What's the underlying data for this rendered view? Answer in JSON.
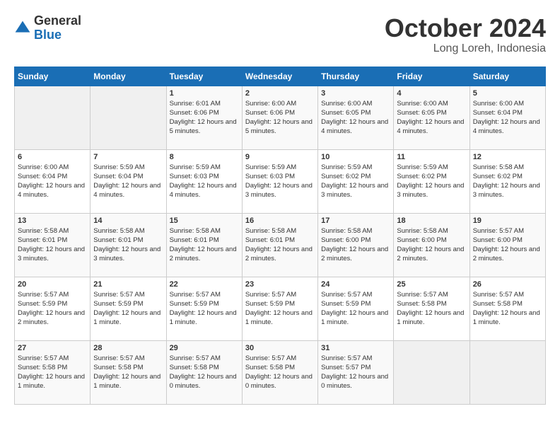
{
  "header": {
    "logo_general": "General",
    "logo_blue": "Blue",
    "month_title": "October 2024",
    "location": "Long Loreh, Indonesia"
  },
  "days_of_week": [
    "Sunday",
    "Monday",
    "Tuesday",
    "Wednesday",
    "Thursday",
    "Friday",
    "Saturday"
  ],
  "weeks": [
    [
      {
        "day": "",
        "empty": true
      },
      {
        "day": "",
        "empty": true
      },
      {
        "day": "1",
        "sunrise": "Sunrise: 6:01 AM",
        "sunset": "Sunset: 6:06 PM",
        "daylight": "Daylight: 12 hours and 5 minutes."
      },
      {
        "day": "2",
        "sunrise": "Sunrise: 6:00 AM",
        "sunset": "Sunset: 6:06 PM",
        "daylight": "Daylight: 12 hours and 5 minutes."
      },
      {
        "day": "3",
        "sunrise": "Sunrise: 6:00 AM",
        "sunset": "Sunset: 6:05 PM",
        "daylight": "Daylight: 12 hours and 4 minutes."
      },
      {
        "day": "4",
        "sunrise": "Sunrise: 6:00 AM",
        "sunset": "Sunset: 6:05 PM",
        "daylight": "Daylight: 12 hours and 4 minutes."
      },
      {
        "day": "5",
        "sunrise": "Sunrise: 6:00 AM",
        "sunset": "Sunset: 6:04 PM",
        "daylight": "Daylight: 12 hours and 4 minutes."
      }
    ],
    [
      {
        "day": "6",
        "sunrise": "Sunrise: 6:00 AM",
        "sunset": "Sunset: 6:04 PM",
        "daylight": "Daylight: 12 hours and 4 minutes."
      },
      {
        "day": "7",
        "sunrise": "Sunrise: 5:59 AM",
        "sunset": "Sunset: 6:04 PM",
        "daylight": "Daylight: 12 hours and 4 minutes."
      },
      {
        "day": "8",
        "sunrise": "Sunrise: 5:59 AM",
        "sunset": "Sunset: 6:03 PM",
        "daylight": "Daylight: 12 hours and 4 minutes."
      },
      {
        "day": "9",
        "sunrise": "Sunrise: 5:59 AM",
        "sunset": "Sunset: 6:03 PM",
        "daylight": "Daylight: 12 hours and 3 minutes."
      },
      {
        "day": "10",
        "sunrise": "Sunrise: 5:59 AM",
        "sunset": "Sunset: 6:02 PM",
        "daylight": "Daylight: 12 hours and 3 minutes."
      },
      {
        "day": "11",
        "sunrise": "Sunrise: 5:59 AM",
        "sunset": "Sunset: 6:02 PM",
        "daylight": "Daylight: 12 hours and 3 minutes."
      },
      {
        "day": "12",
        "sunrise": "Sunrise: 5:58 AM",
        "sunset": "Sunset: 6:02 PM",
        "daylight": "Daylight: 12 hours and 3 minutes."
      }
    ],
    [
      {
        "day": "13",
        "sunrise": "Sunrise: 5:58 AM",
        "sunset": "Sunset: 6:01 PM",
        "daylight": "Daylight: 12 hours and 3 minutes."
      },
      {
        "day": "14",
        "sunrise": "Sunrise: 5:58 AM",
        "sunset": "Sunset: 6:01 PM",
        "daylight": "Daylight: 12 hours and 3 minutes."
      },
      {
        "day": "15",
        "sunrise": "Sunrise: 5:58 AM",
        "sunset": "Sunset: 6:01 PM",
        "daylight": "Daylight: 12 hours and 2 minutes."
      },
      {
        "day": "16",
        "sunrise": "Sunrise: 5:58 AM",
        "sunset": "Sunset: 6:01 PM",
        "daylight": "Daylight: 12 hours and 2 minutes."
      },
      {
        "day": "17",
        "sunrise": "Sunrise: 5:58 AM",
        "sunset": "Sunset: 6:00 PM",
        "daylight": "Daylight: 12 hours and 2 minutes."
      },
      {
        "day": "18",
        "sunrise": "Sunrise: 5:58 AM",
        "sunset": "Sunset: 6:00 PM",
        "daylight": "Daylight: 12 hours and 2 minutes."
      },
      {
        "day": "19",
        "sunrise": "Sunrise: 5:57 AM",
        "sunset": "Sunset: 6:00 PM",
        "daylight": "Daylight: 12 hours and 2 minutes."
      }
    ],
    [
      {
        "day": "20",
        "sunrise": "Sunrise: 5:57 AM",
        "sunset": "Sunset: 5:59 PM",
        "daylight": "Daylight: 12 hours and 2 minutes."
      },
      {
        "day": "21",
        "sunrise": "Sunrise: 5:57 AM",
        "sunset": "Sunset: 5:59 PM",
        "daylight": "Daylight: 12 hours and 1 minute."
      },
      {
        "day": "22",
        "sunrise": "Sunrise: 5:57 AM",
        "sunset": "Sunset: 5:59 PM",
        "daylight": "Daylight: 12 hours and 1 minute."
      },
      {
        "day": "23",
        "sunrise": "Sunrise: 5:57 AM",
        "sunset": "Sunset: 5:59 PM",
        "daylight": "Daylight: 12 hours and 1 minute."
      },
      {
        "day": "24",
        "sunrise": "Sunrise: 5:57 AM",
        "sunset": "Sunset: 5:59 PM",
        "daylight": "Daylight: 12 hours and 1 minute."
      },
      {
        "day": "25",
        "sunrise": "Sunrise: 5:57 AM",
        "sunset": "Sunset: 5:58 PM",
        "daylight": "Daylight: 12 hours and 1 minute."
      },
      {
        "day": "26",
        "sunrise": "Sunrise: 5:57 AM",
        "sunset": "Sunset: 5:58 PM",
        "daylight": "Daylight: 12 hours and 1 minute."
      }
    ],
    [
      {
        "day": "27",
        "sunrise": "Sunrise: 5:57 AM",
        "sunset": "Sunset: 5:58 PM",
        "daylight": "Daylight: 12 hours and 1 minute."
      },
      {
        "day": "28",
        "sunrise": "Sunrise: 5:57 AM",
        "sunset": "Sunset: 5:58 PM",
        "daylight": "Daylight: 12 hours and 1 minute."
      },
      {
        "day": "29",
        "sunrise": "Sunrise: 5:57 AM",
        "sunset": "Sunset: 5:58 PM",
        "daylight": "Daylight: 12 hours and 0 minutes."
      },
      {
        "day": "30",
        "sunrise": "Sunrise: 5:57 AM",
        "sunset": "Sunset: 5:58 PM",
        "daylight": "Daylight: 12 hours and 0 minutes."
      },
      {
        "day": "31",
        "sunrise": "Sunrise: 5:57 AM",
        "sunset": "Sunset: 5:57 PM",
        "daylight": "Daylight: 12 hours and 0 minutes."
      },
      {
        "day": "",
        "empty": true
      },
      {
        "day": "",
        "empty": true
      }
    ]
  ]
}
